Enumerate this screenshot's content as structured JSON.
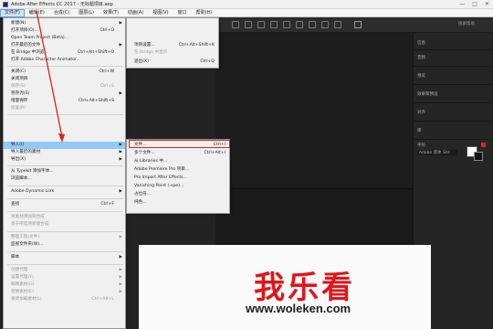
{
  "window": {
    "title": "Adobe After Effects CC 2017 - 无标题项目.aep",
    "controls": [
      "—",
      "□",
      "✕"
    ]
  },
  "menubar": [
    "文件(F)",
    "编辑(E)",
    "合成(C)",
    "图层(L)",
    "效果(T)",
    "动画(A)",
    "视图(V)",
    "窗口",
    "帮助(H)"
  ],
  "file_menu": {
    "items": [
      {
        "label": "新建(N)",
        "shortcut": "",
        "arrow": true,
        "disabled": false
      },
      {
        "label": "打开项目(O)...",
        "shortcut": "Ctrl+O",
        "arrow": false,
        "disabled": false
      },
      {
        "label": "Open Team Project (Beta)...",
        "shortcut": "",
        "arrow": false,
        "disabled": false
      },
      {
        "label": "打开最近的文件",
        "shortcut": "",
        "arrow": true,
        "disabled": false
      },
      {
        "label": "在 Bridge 中浏览...",
        "shortcut": "Ctrl+Alt+Shift+O",
        "arrow": false,
        "disabled": false
      },
      {
        "label": "打开 Adobe Character Animator...",
        "shortcut": "",
        "arrow": false,
        "disabled": false
      },
      {
        "label": "关闭(C)",
        "shortcut": "Ctrl+W",
        "arrow": false,
        "disabled": false
      },
      {
        "label": "关闭项目",
        "shortcut": "",
        "arrow": false,
        "disabled": false
      },
      {
        "label": "保存(S)",
        "shortcut": "Ctrl+S",
        "arrow": false,
        "disabled": true
      },
      {
        "label": "另存为(S)",
        "shortcut": "",
        "arrow": true,
        "disabled": false
      },
      {
        "label": "增量保存",
        "shortcut": "Ctrl+Alt+Shift+S",
        "arrow": false,
        "disabled": false
      },
      {
        "label": "恢复(R)",
        "shortcut": "",
        "arrow": false,
        "disabled": true
      },
      {
        "label": "导入(I)",
        "shortcut": "",
        "arrow": true,
        "disabled": false
      },
      {
        "label": "导入最近的素材",
        "shortcut": "",
        "arrow": true,
        "disabled": false
      },
      {
        "label": "导出(X)",
        "shortcut": "",
        "arrow": true,
        "disabled": false
      },
      {
        "label": "从 Typekit 添加字体...",
        "shortcut": "",
        "arrow": false,
        "disabled": false
      },
      {
        "label": "浏览脚本...",
        "shortcut": "",
        "arrow": false,
        "disabled": false
      },
      {
        "label": "Adobe Dynamic Link",
        "shortcut": "",
        "arrow": true,
        "disabled": false
      },
      {
        "label": "查找",
        "shortcut": "Ctrl+F",
        "arrow": false,
        "disabled": false
      },
      {
        "label": "将素材添加到合成",
        "shortcut": "",
        "arrow": false,
        "disabled": true
      },
      {
        "label": "基于所选项新建合成",
        "shortcut": "",
        "arrow": false,
        "disabled": true
      },
      {
        "label": "整理工程(文件)",
        "shortcut": "",
        "arrow": true,
        "disabled": true
      },
      {
        "label": "监视文件夹(W)...",
        "shortcut": "",
        "arrow": false,
        "disabled": false
      },
      {
        "label": "脚本",
        "shortcut": "",
        "arrow": true,
        "disabled": false
      },
      {
        "label": "创建代理",
        "shortcut": "",
        "arrow": true,
        "disabled": true
      },
      {
        "label": "设置代理(Y)",
        "shortcut": "",
        "arrow": true,
        "disabled": true
      },
      {
        "label": "解释素材(G)",
        "shortcut": "",
        "arrow": true,
        "disabled": true
      },
      {
        "label": "替换素材(E)",
        "shortcut": "",
        "arrow": true,
        "disabled": true
      },
      {
        "label": "重新加载素材(L)",
        "shortcut": "Ctrl+Alt+L",
        "arrow": false,
        "disabled": true
      }
    ]
  },
  "recent_submenu": {
    "items": [
      {
        "label": "项目设置...",
        "shortcut": "Ctrl+Alt+Shift+K",
        "disabled": false
      },
      {
        "label": "在 Bridge 中显示",
        "shortcut": "",
        "disabled": true
      },
      {
        "label": "退出(X)",
        "shortcut": "Ctrl+Q",
        "disabled": false
      }
    ]
  },
  "import_submenu": {
    "items": [
      {
        "label": "文件...",
        "shortcut": "Ctrl+I",
        "highlighted": true
      },
      {
        "label": "多个文件...",
        "shortcut": "Ctrl+Alt+I",
        "highlighted": false
      },
      {
        "label": "从 Libraries 中...",
        "shortcut": "",
        "highlighted": false
      },
      {
        "label": "Adobe Premiere Pro 项目...",
        "shortcut": "",
        "highlighted": false
      },
      {
        "label": "Pro Import After Effects...",
        "shortcut": "",
        "highlighted": false
      },
      {
        "label": "Vanishing Point (.vpe)...",
        "shortcut": "",
        "highlighted": false
      },
      {
        "label": "占位符...",
        "shortcut": "",
        "highlighted": false
      },
      {
        "label": "纯色...",
        "shortcut": "",
        "highlighted": false
      }
    ]
  },
  "right_panel": {
    "search": "搜索帮助",
    "sections": [
      "信息",
      "音频",
      "预览",
      "效果和预设",
      "对齐",
      "库",
      "字符"
    ],
    "font": "Adobe 黑体 Std",
    "accent": "#e02020"
  },
  "watermark": {
    "brand": "我乐看",
    "url": "www.woleken.com",
    "color": "#e0161b"
  }
}
